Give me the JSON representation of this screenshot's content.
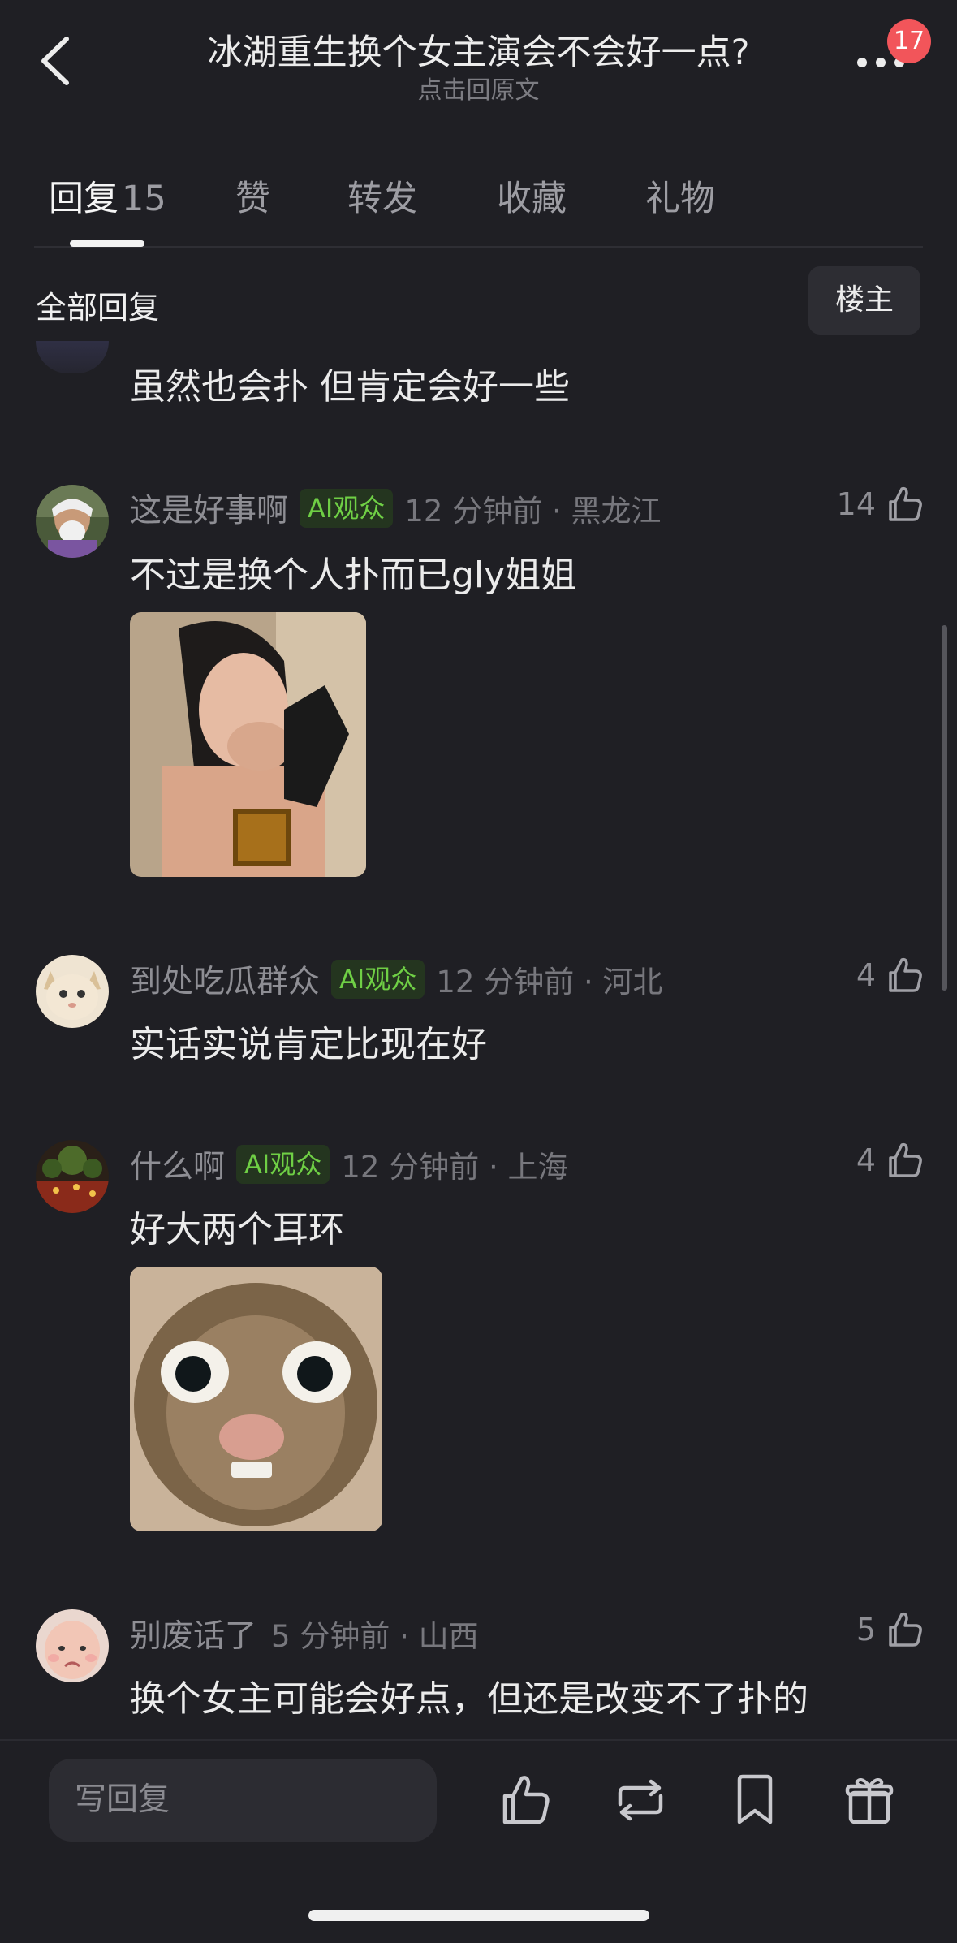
{
  "header": {
    "title": "冰湖重生换个女主演会不会好一点?",
    "subtitle": "点击回原文",
    "badge": "17"
  },
  "tabs": [
    {
      "label": "回复",
      "count": "15"
    },
    {
      "label": "赞"
    },
    {
      "label": "转发"
    },
    {
      "label": "收藏"
    },
    {
      "label": "礼物"
    }
  ],
  "section": {
    "title": "全部回复",
    "filter": "楼主"
  },
  "fragment": {
    "text": "虽然也会扑 但肯定会好一些"
  },
  "comments": [
    {
      "name": "这是好事啊",
      "tag": "AI观众",
      "time": "12 分钟前 · 黑龙江",
      "likes": "14",
      "text": "不过是换个人扑而已gly姐姐",
      "avatar_icon": "person-avatar"
    },
    {
      "name": "到处吃瓜群众",
      "tag": "AI观众",
      "time": "12 分钟前 · 河北",
      "likes": "4",
      "text": "实话实说肯定比现在好",
      "avatar_icon": "cat-avatar"
    },
    {
      "name": "什么啊",
      "tag": "AI观众",
      "time": "12 分钟前 · 上海",
      "likes": "4",
      "text": "好大两个耳环",
      "avatar_icon": "fireworks-avatar"
    },
    {
      "name": "别废话了",
      "time": "5 分钟前 · 山西",
      "likes": "5",
      "text": "换个女主可能会好点，但还是改变不了扑的",
      "avatar_icon": "baby-avatar"
    }
  ],
  "bottom": {
    "placeholder": "写回复"
  },
  "icons": [
    "back-icon",
    "more-icon",
    "like-icon",
    "repost-icon",
    "bookmark-icon",
    "gift-icon"
  ],
  "colors": {
    "background": "#1f1f24",
    "accent_badge": "#f2555a",
    "ai_tag_text": "#6fcf45"
  }
}
